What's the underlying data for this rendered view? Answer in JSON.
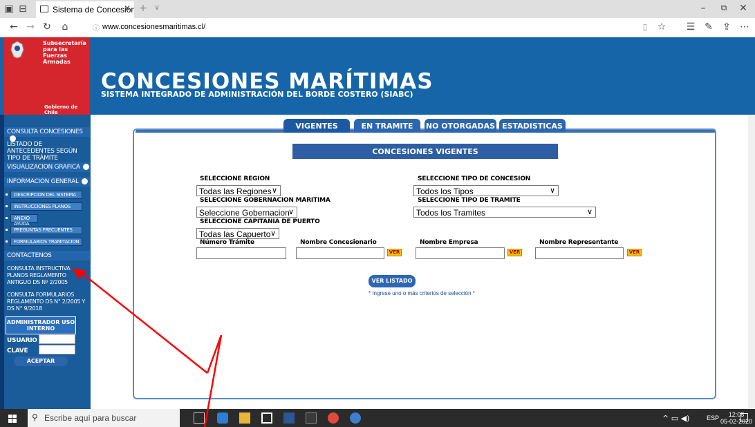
{
  "browser": {
    "tab_title": "Sistema de Concesione:",
    "url": "www.concesionesmaritimas.cl/"
  },
  "header": {
    "org_name": "Subsecretaría para las Fuerzas Armadas",
    "gov_label": "Gobierno de Chile",
    "title": "CONCESIONES MARÍTIMAS",
    "subtitle": "SISTEMA INTEGRADO DE ADMINISTRACIÓN DEL BORDE COSTERO (SIABC)"
  },
  "sidebar": {
    "consulta_concesiones": "CONSULTA CONCESIONES",
    "listado": "LISTADO DE ANTECEDENTES SEGÚN TIPO DE TRÁMITE",
    "visualizacion": "VISUALIZACION GRAFICA",
    "informacion": "INFORMACION GENERAL",
    "sub_items": [
      "DESCRIPCION DEL SISTEMA",
      "INSTRUCCIONES PLANOS",
      "ANEXO AYUDA",
      "PREGUNTAS FRECUENTES",
      "FORMULARIOS TRAMITACION"
    ],
    "contactenos": "CONTACTENOS",
    "consulta_instructiva": "CONSULTA INSTRUCTIVA PLANOS REGLAMENTO ANTIGUO DS Nº 2/2005",
    "consulta_formularios": "CONSULTA FORMULARIOS REGLAMENTO DS N° 2/2005 Y DS N° 9/2018",
    "admin_label": "ADMINISTRADOR USO INTERNO",
    "usuario_label": "USUARIO",
    "clave_label": "CLAVE",
    "aceptar": "ACEPTAR"
  },
  "tabs": [
    "VIGENTES",
    "EN TRAMITE",
    "NO OTORGADAS",
    "ESTADISTICAS"
  ],
  "content": {
    "section_title": "CONCESIONES VIGENTES",
    "region_label": "SELECCIONE REGION",
    "region_value": "Todas las Regiones",
    "gobernacion_label": "SELECCIONE GOBERNACION MARITIMA",
    "gobernacion_value": "Seleccione Gobernacion",
    "capitania_label": "SELECCIONE CAPITANIA DE PUERTO",
    "capitania_value": "Todas las Capuerto",
    "tipo_concesion_label": "SELECCIONE TIPO DE CONCESION",
    "tipo_concesion_value": "Todos los Tipos",
    "tipo_tramite_label": "SELECCIONE TIPO DE TRAMITE",
    "tipo_tramite_value": "Todos los Tramites",
    "numero_tramite_label": "Número Trámite",
    "nombre_concesionario_label": "Nombre Concesionario",
    "nombre_empresa_label": "Nombre Empresa",
    "nombre_representante_label": "Nombre Representante",
    "ver": "VER",
    "ver_listado": "VER LISTADO",
    "hint": "* Ingrese uno o más criterios de selección *"
  },
  "taskbar": {
    "search_placeholder": "Escribe aquí para buscar",
    "lang": "ESP",
    "time": "12:08",
    "date": "05-02-2020"
  },
  "colors": {
    "header_blue": "#1565a8",
    "gov_red": "#d6262d",
    "sidebar_blue": "#1a5b9a",
    "annotation_arrow": "#ff0000"
  }
}
